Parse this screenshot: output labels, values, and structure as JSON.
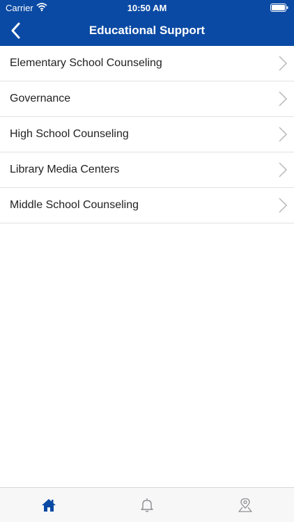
{
  "status_bar": {
    "carrier": "Carrier",
    "time": "10:50 AM"
  },
  "nav": {
    "title": "Educational Support",
    "back_icon": "chevron-left-icon"
  },
  "list": {
    "items": [
      {
        "label": "Elementary School Counseling"
      },
      {
        "label": "Governance"
      },
      {
        "label": "High School Counseling"
      },
      {
        "label": "Library Media Centers"
      },
      {
        "label": "Middle School Counseling"
      }
    ]
  },
  "tab_bar": {
    "tabs": [
      {
        "icon": "home-icon",
        "active": true
      },
      {
        "icon": "bell-icon",
        "active": false
      },
      {
        "icon": "map-pin-icon",
        "active": false
      }
    ]
  },
  "colors": {
    "header": "#0a4aa4",
    "active_tab": "#0a4aa4",
    "inactive_tab": "#8e8e93",
    "separator": "#e1e1e1"
  }
}
